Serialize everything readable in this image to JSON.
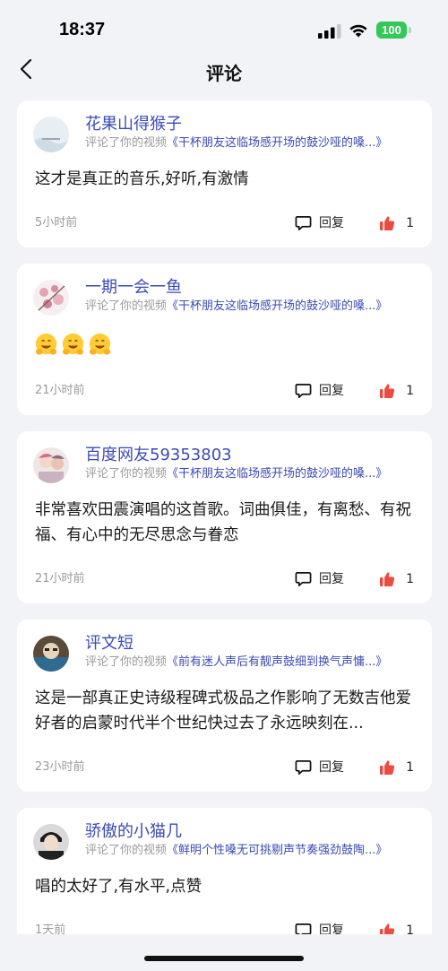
{
  "status_bar": {
    "time": "18:37",
    "battery": "100"
  },
  "nav": {
    "title": "评论",
    "back_icon": "chevron-left-icon"
  },
  "labels": {
    "commented_prefix": "评论了你的视频",
    "reply": "回复"
  },
  "colors": {
    "username": "#3b4bb5",
    "like": "#ee4b3f",
    "background": "#f2f3f7"
  },
  "comments": [
    {
      "user": "花果山得猴子",
      "video": "《干杯朋友这临场感开场的鼓沙哑的嗓...》",
      "text": "这才是真正的音乐,好听,有激情",
      "time": "5小时前",
      "likes": "1"
    },
    {
      "user": "一期一会一鱼",
      "video": "《干杯朋友这临场感开场的鼓沙哑的嗓...》",
      "text": "",
      "emojis": [
        "hugging-face-emoji",
        "hugging-face-emoji",
        "hugging-face-emoji"
      ],
      "time": "21小时前",
      "likes": "1"
    },
    {
      "user": "百度网友59353803",
      "video": "《干杯朋友这临场感开场的鼓沙哑的嗓...》",
      "text": "非常喜欢田震演唱的这首歌。词曲俱佳，有离愁、有祝福、有心中的无尽思念与眷恋",
      "time": "21小时前",
      "likes": "1"
    },
    {
      "user": "评文短",
      "video": "《前有迷人声后有靓声鼓细到换气声慵...》",
      "text": "这是一部真正史诗级程碑式极品之作影响了无数吉他爱好者的启蒙时代半个世纪快过去了永远映刻在...",
      "time": "23小时前",
      "likes": "1"
    },
    {
      "user": "骄傲的小猫几",
      "video": "《鲜明个性嗓无可挑剔声节奏强劲鼓陶...》",
      "text": "唱的太好了,有水平,点赞",
      "time": "1天前",
      "likes": "1"
    }
  ]
}
